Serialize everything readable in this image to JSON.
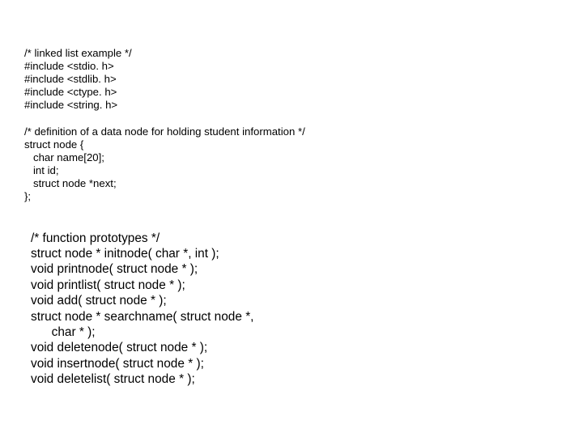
{
  "slide": {
    "blockA": {
      "l0": "/* linked list example */",
      "l1": "#include <stdio. h>",
      "l2": "#include <stdlib. h>",
      "l3": "#include <ctype. h>",
      "l4": "#include <string. h>",
      "blank1": "",
      "l5": "/* definition of a data node for holding student information */",
      "l6": "struct node {",
      "l7": "   char name[20];",
      "l8": "   int id;",
      "l9": "   struct node *next;",
      "l10": "};"
    },
    "blockB": {
      "l0": "/* function prototypes */",
      "l1": "struct node * initnode( char *, int );",
      "l2": "void printnode( struct node * );",
      "l3": "void printlist( struct node * );",
      "l4": "void add( struct node * );",
      "l5": "struct node * searchname( struct node *,",
      "l6": "      char * );",
      "l7": "void deletenode( struct node * );",
      "l8": "void insertnode( struct node * );",
      "l9": "void deletelist( struct node * );"
    }
  }
}
